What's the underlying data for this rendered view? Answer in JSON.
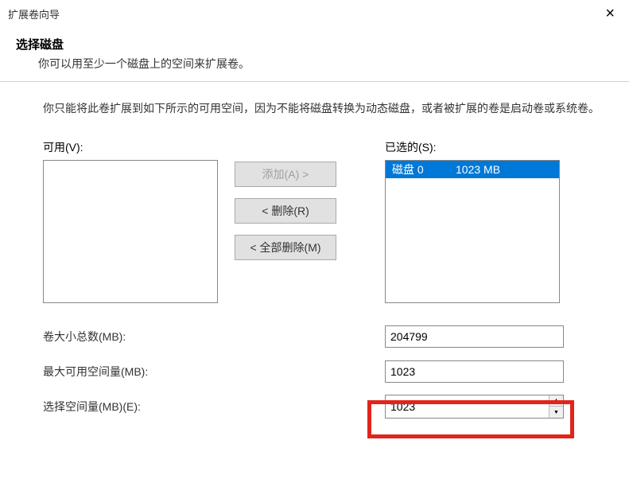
{
  "window": {
    "title": "扩展卷向导"
  },
  "header": {
    "title": "选择磁盘",
    "subtitle": "你可以用至少一个磁盘上的空间来扩展卷。"
  },
  "description": "你只能将此卷扩展到如下所示的可用空间，因为不能将磁盘转换为动态磁盘，或者被扩展的卷是启动卷或系统卷。",
  "labels": {
    "available": "可用(V):",
    "selected": "已选的(S):"
  },
  "buttons": {
    "add": "添加(A) >",
    "remove": "< 删除(R)",
    "remove_all": "< 全部删除(M)"
  },
  "selected_items": [
    {
      "name": "磁盘 0",
      "size": "1023 MB"
    }
  ],
  "fields": {
    "total_size_label": "卷大小总数(MB):",
    "total_size_value": "204799",
    "max_avail_label": "最大可用空间量(MB):",
    "max_avail_value": "1023",
    "select_amt_label": "选择空间量(MB)(E):",
    "select_amt_value": "1023"
  }
}
